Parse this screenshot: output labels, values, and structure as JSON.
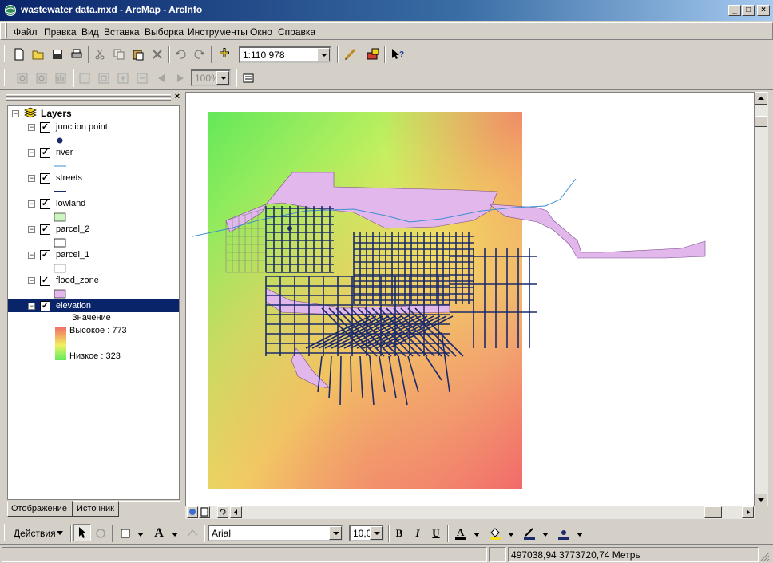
{
  "window": {
    "title": "wastewater data.mxd - ArcMap - ArcInfo",
    "minimize": "_",
    "maximize": "□",
    "close": "×"
  },
  "menu": [
    "Файл",
    "Правка",
    "Вид",
    "Вставка",
    "Выборка",
    "Инструменты",
    "Окно",
    "Справка"
  ],
  "toolbar": {
    "scale_value": "1:110 978",
    "zoom_value": "100%"
  },
  "toc": {
    "root_label": "Layers",
    "layers": [
      {
        "name": "junction point",
        "checked": true
      },
      {
        "name": "river",
        "checked": true
      },
      {
        "name": "streets",
        "checked": true
      },
      {
        "name": "lowland",
        "checked": true
      },
      {
        "name": "parcel_2",
        "checked": true
      },
      {
        "name": "parcel_1",
        "checked": true
      },
      {
        "name": "flood_zone",
        "checked": true
      },
      {
        "name": "elevation",
        "checked": true,
        "selected": true
      }
    ],
    "elevation_legend": {
      "heading": "Значение",
      "high": "Высокое : 773",
      "low": "Низкое : 323"
    },
    "tabs": [
      "Отображение",
      "Источник"
    ]
  },
  "drawing_toolbar": {
    "actions_label": "Действия",
    "font_name": "Arial",
    "font_size": "10,0",
    "bold": "B",
    "italic": "I",
    "underline": "U",
    "text_tool": "A"
  },
  "status": {
    "coordinates": "497038,94  3773720,74 Метрь"
  },
  "colors": {
    "title_start": "#0a246a",
    "title_end": "#a6caf0",
    "selected_row": "#0a246a",
    "lowland_fill": "#ccf5c0",
    "flood_zone_fill": "#e2b8ec",
    "river_line": "#3d8fd0",
    "streets_line": "#1a2a6a",
    "junction_point": "#1a2a6a",
    "elevation_high": "#f26a6a",
    "elevation_low": "#64e85a"
  }
}
